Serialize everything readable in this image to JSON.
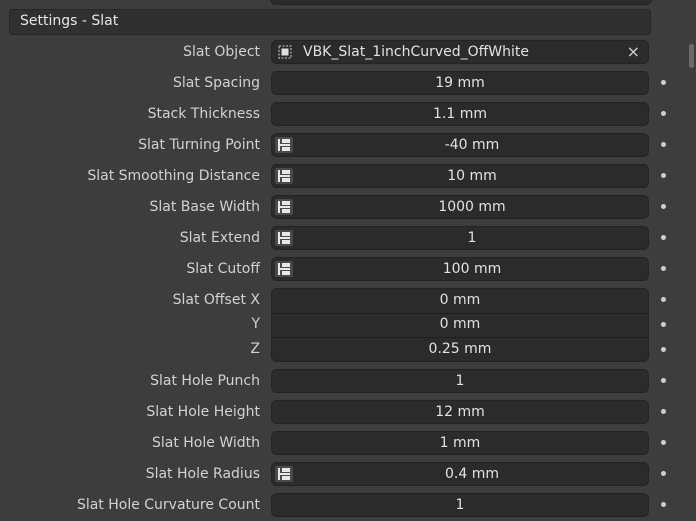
{
  "panel": {
    "title": "Settings - Slat"
  },
  "slat_object": {
    "label": "Slat Object",
    "value": "VBK_Slat_1inchCurved_OffWhite",
    "clear_icon": "×"
  },
  "fields": [
    {
      "label": "Slat Spacing",
      "value": "19 mm",
      "icon": null
    },
    {
      "label": "Stack Thickness",
      "value": "1.1 mm",
      "icon": null
    },
    {
      "label": "Slat Turning Point",
      "value": "-40 mm",
      "icon": "driver-icon"
    },
    {
      "label": "Slat Smoothing Distance",
      "value": "10 mm",
      "icon": "driver-icon"
    },
    {
      "label": "Slat Base Width",
      "value": "1000 mm",
      "icon": "driver-icon"
    },
    {
      "label": "Slat Extend",
      "value": "1",
      "icon": "driver-icon"
    },
    {
      "label": "Slat Cutoff",
      "value": "100 mm",
      "icon": "driver-icon"
    }
  ],
  "offset": {
    "label_x": "Slat Offset X",
    "label_y": "Y",
    "label_z": "Z",
    "x": "0 mm",
    "y": "0 mm",
    "z": "0.25 mm"
  },
  "hole_fields": [
    {
      "label": "Slat Hole Punch",
      "value": "1",
      "icon": null
    },
    {
      "label": "Slat Hole Height",
      "value": "12 mm",
      "icon": null
    },
    {
      "label": "Slat Hole Width",
      "value": "1 mm",
      "icon": null
    },
    {
      "label": "Slat Hole Radius",
      "value": "0.4 mm",
      "icon": "driver-icon"
    },
    {
      "label": "Slat Hole Curvature Count",
      "value": "1",
      "icon": null
    }
  ]
}
